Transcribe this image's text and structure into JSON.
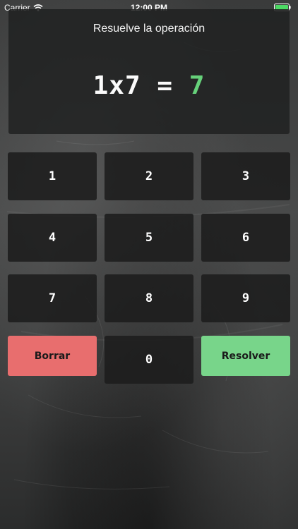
{
  "status_bar": {
    "carrier": "Carrier",
    "time": "12:00 PM",
    "wifi_icon": "wifi-icon",
    "battery_icon": "battery-icon",
    "battery_color": "#4cd964"
  },
  "problem": {
    "instruction": "Resuelve la operación",
    "operand_a": "1",
    "operator": "x",
    "operand_b": "7",
    "equals": "=",
    "answer": "7",
    "answer_color": "#66d17a"
  },
  "keypad": {
    "digits": [
      "1",
      "2",
      "3",
      "4",
      "5",
      "6",
      "7",
      "8",
      "9",
      "0"
    ],
    "delete_label": "Borrar",
    "delete_color": "#e86e6e",
    "solve_label": "Resolver",
    "solve_color": "#78d58a"
  }
}
